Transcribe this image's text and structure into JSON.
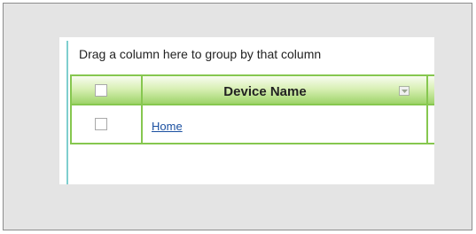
{
  "grid": {
    "group_hint": "Drag a column here to group by that column",
    "header": {
      "column_title": "Device Name",
      "select_all_checked": false,
      "sort_icon": "column-menu-icon"
    },
    "rows": [
      {
        "device_name": "Home",
        "checked": false
      }
    ]
  },
  "colors": {
    "header_green": "#9ed46a",
    "grid_line": "#86c74f",
    "link": "#1a4fa0"
  }
}
